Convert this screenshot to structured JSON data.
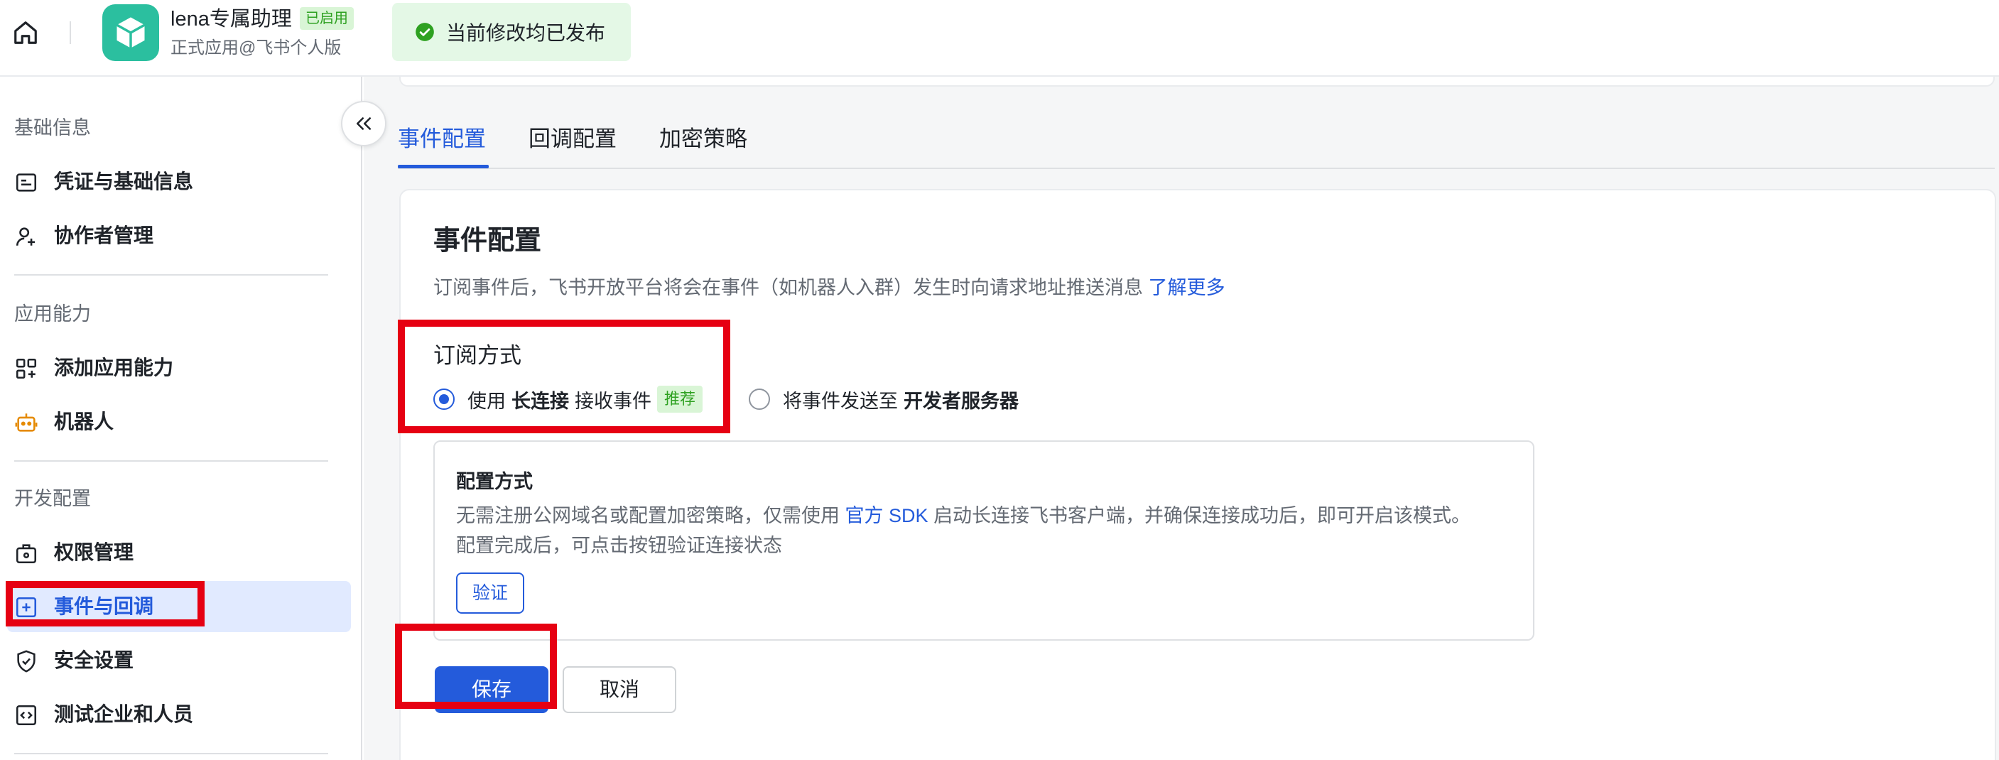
{
  "header": {
    "app_name": "lena专属助理",
    "status_badge": "已启用",
    "subtitle": "正式应用@飞书个人版",
    "toast": "当前修改均已发布"
  },
  "sidebar": {
    "sections": [
      {
        "title": "基础信息",
        "items": [
          {
            "label": "凭证与基础信息",
            "icon": "credential-icon"
          },
          {
            "label": "协作者管理",
            "icon": "user-add-icon"
          }
        ]
      },
      {
        "title": "应用能力",
        "items": [
          {
            "label": "添加应用能力",
            "icon": "apps-add-icon"
          },
          {
            "label": "机器人",
            "icon": "robot-icon"
          }
        ]
      },
      {
        "title": "开发配置",
        "items": [
          {
            "label": "权限管理",
            "icon": "permission-icon"
          },
          {
            "label": "事件与回调",
            "icon": "event-icon",
            "active": true
          },
          {
            "label": "安全设置",
            "icon": "shield-icon"
          },
          {
            "label": "测试企业和人员",
            "icon": "code-icon"
          }
        ]
      }
    ]
  },
  "tabs": [
    "事件配置",
    "回调配置",
    "加密策略"
  ],
  "content": {
    "title": "事件配置",
    "desc": "订阅事件后，飞书开放平台将会在事件（如机器人入群）发生时向请求地址推送消息",
    "learn_more": "了解更多",
    "subscribe_title": "订阅方式",
    "option1": {
      "prefix": "使用",
      "bold": "长连接",
      "suffix": "接收事件",
      "tag": "推荐",
      "selected": true
    },
    "option2": {
      "prefix": "将事件发送至",
      "bold": "开发者服务器",
      "selected": false
    },
    "config": {
      "title": "配置方式",
      "line1_a": "无需注册公网域名或配置加密策略，仅需使用",
      "line1_link": "官方 SDK",
      "line1_b": "启动长连接飞书客户端，并确保连接成功后，即可开启该模式。",
      "line2": "配置完成后，可点击按钮验证连接状态",
      "verify": "验证"
    },
    "save": "保存",
    "cancel": "取消"
  },
  "colors": {
    "primary": "#245bdb",
    "success": "#2ea121",
    "annotation": "#e60012"
  }
}
